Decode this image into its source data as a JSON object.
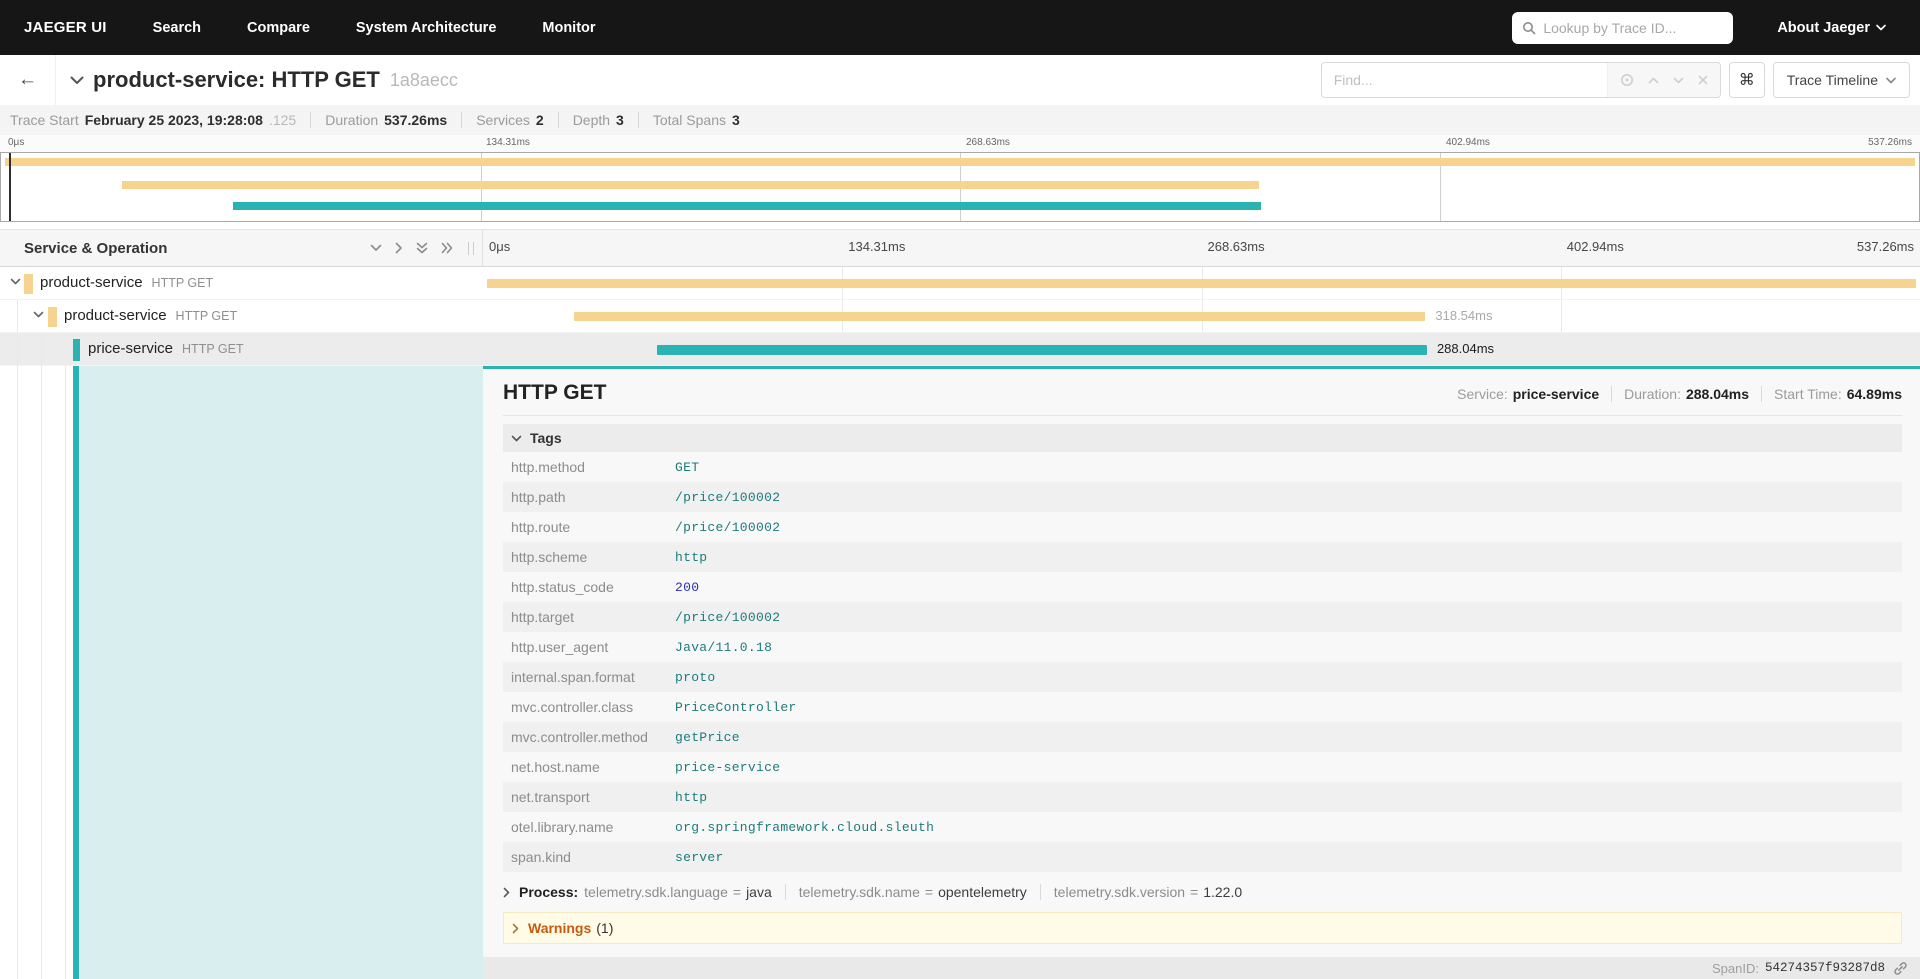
{
  "colors": {
    "nav-bg": "#161616",
    "yellow": "#f6d38e",
    "teal": "#29b3b3",
    "teal-light": "#d9efef",
    "tag-val": "#1e7b7b",
    "tag-num": "#2d2dc4",
    "warn": "#c75b10",
    "panel-bg": "#f8f8f8"
  },
  "nav": {
    "brand": "JAEGER UI",
    "items": [
      {
        "label": "Search"
      },
      {
        "label": "Compare"
      },
      {
        "label": "System Architecture"
      },
      {
        "label": "Monitor"
      }
    ],
    "lookup_placeholder": "Lookup by Trace ID...",
    "about_label": "About Jaeger"
  },
  "header": {
    "title": "product-service: HTTP GET",
    "trace_id": "1a8aecc",
    "find_placeholder": "Find...",
    "view_button": "Trace Timeline"
  },
  "summary": {
    "items": [
      {
        "label": "Trace Start",
        "value": "February 25 2023, 19:28:08",
        "suffix": ".125"
      },
      {
        "label": "Duration",
        "value": "537.26ms",
        "suffix": ""
      },
      {
        "label": "Services",
        "value": "2",
        "suffix": ""
      },
      {
        "label": "Depth",
        "value": "3",
        "suffix": ""
      },
      {
        "label": "Total Spans",
        "value": "3",
        "suffix": ""
      }
    ]
  },
  "timeline": {
    "column_header": "Service & Operation",
    "ticks": [
      "0μs",
      "134.31ms",
      "268.63ms",
      "402.94ms",
      "537.26ms"
    ]
  },
  "spans": [
    {
      "service": "product-service",
      "operation": "HTTP GET",
      "duration_label": ""
    },
    {
      "service": "product-service",
      "operation": "HTTP GET",
      "duration_label": "318.54ms"
    },
    {
      "service": "price-service",
      "operation": "HTTP GET",
      "duration_label": "288.04ms"
    }
  ],
  "detail": {
    "title": "HTTP GET",
    "meta": [
      {
        "label": "Service:",
        "value": "price-service"
      },
      {
        "label": "Duration:",
        "value": "288.04ms"
      },
      {
        "label": "Start Time:",
        "value": "64.89ms"
      }
    ],
    "tags_header": "Tags",
    "tags": [
      {
        "key": "http.method",
        "value": "GET"
      },
      {
        "key": "http.path",
        "value": "/price/100002"
      },
      {
        "key": "http.route",
        "value": "/price/100002"
      },
      {
        "key": "http.scheme",
        "value": "http"
      },
      {
        "key": "http.status_code",
        "value": "200"
      },
      {
        "key": "http.target",
        "value": "/price/100002"
      },
      {
        "key": "http.user_agent",
        "value": "Java/11.0.18"
      },
      {
        "key": "internal.span.format",
        "value": "proto"
      },
      {
        "key": "mvc.controller.class",
        "value": "PriceController"
      },
      {
        "key": "mvc.controller.method",
        "value": "getPrice"
      },
      {
        "key": "net.host.name",
        "value": "price-service"
      },
      {
        "key": "net.transport",
        "value": "http"
      },
      {
        "key": "otel.library.name",
        "value": "org.springframework.cloud.sleuth"
      },
      {
        "key": "span.kind",
        "value": "server"
      }
    ],
    "process": {
      "label": "Process:",
      "eq": "=",
      "items": [
        {
          "key": "telemetry.sdk.language",
          "value": "java"
        },
        {
          "key": "telemetry.sdk.name",
          "value": "opentelemetry"
        },
        {
          "key": "telemetry.sdk.version",
          "value": "1.22.0"
        }
      ]
    },
    "warnings": {
      "label": "Warnings",
      "count": "(1)"
    },
    "footer": {
      "label": "SpanID:",
      "value": "54274357f93287d8"
    }
  }
}
